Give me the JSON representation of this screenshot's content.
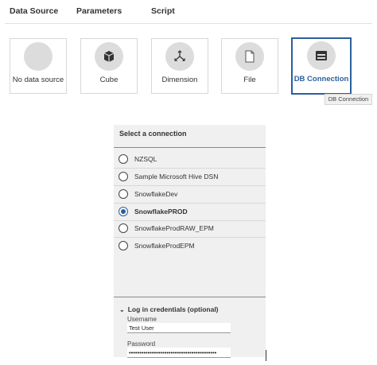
{
  "tabs": {
    "data_source": "Data Source",
    "parameters": "Parameters",
    "script": "Script"
  },
  "sources": [
    {
      "label": "No data source",
      "icon": "none"
    },
    {
      "label": "Cube",
      "icon": "cube-icon"
    },
    {
      "label": "Dimension",
      "icon": "dimension-icon"
    },
    {
      "label": "File",
      "icon": "file-icon"
    },
    {
      "label": "DB Connection",
      "icon": "database-icon",
      "selected": true
    }
  ],
  "tooltip": "DB Connection",
  "connection_panel": {
    "title": "Select a connection",
    "connections": [
      {
        "label": "NZSQL",
        "selected": false
      },
      {
        "label": "Sample Microsoft Hive DSN",
        "selected": false
      },
      {
        "label": "SnowflakeDev",
        "selected": false
      },
      {
        "label": "SnowflakePROD",
        "selected": true
      },
      {
        "label": "SnowflakeProdRAW_EPM",
        "selected": false
      },
      {
        "label": "SnowflakeProdEPM",
        "selected": false
      }
    ]
  },
  "credentials": {
    "header": "Log in credentials (optional)",
    "username_label": "Username",
    "username_value": "Test User",
    "password_label": "Password",
    "password_value": "••••••••••••••••••••••••••••••••••••••••••"
  },
  "colors": {
    "accent": "#2b5f9e",
    "icon_circle": "#dcdcdc",
    "panel_bg": "#f0f0f0"
  }
}
